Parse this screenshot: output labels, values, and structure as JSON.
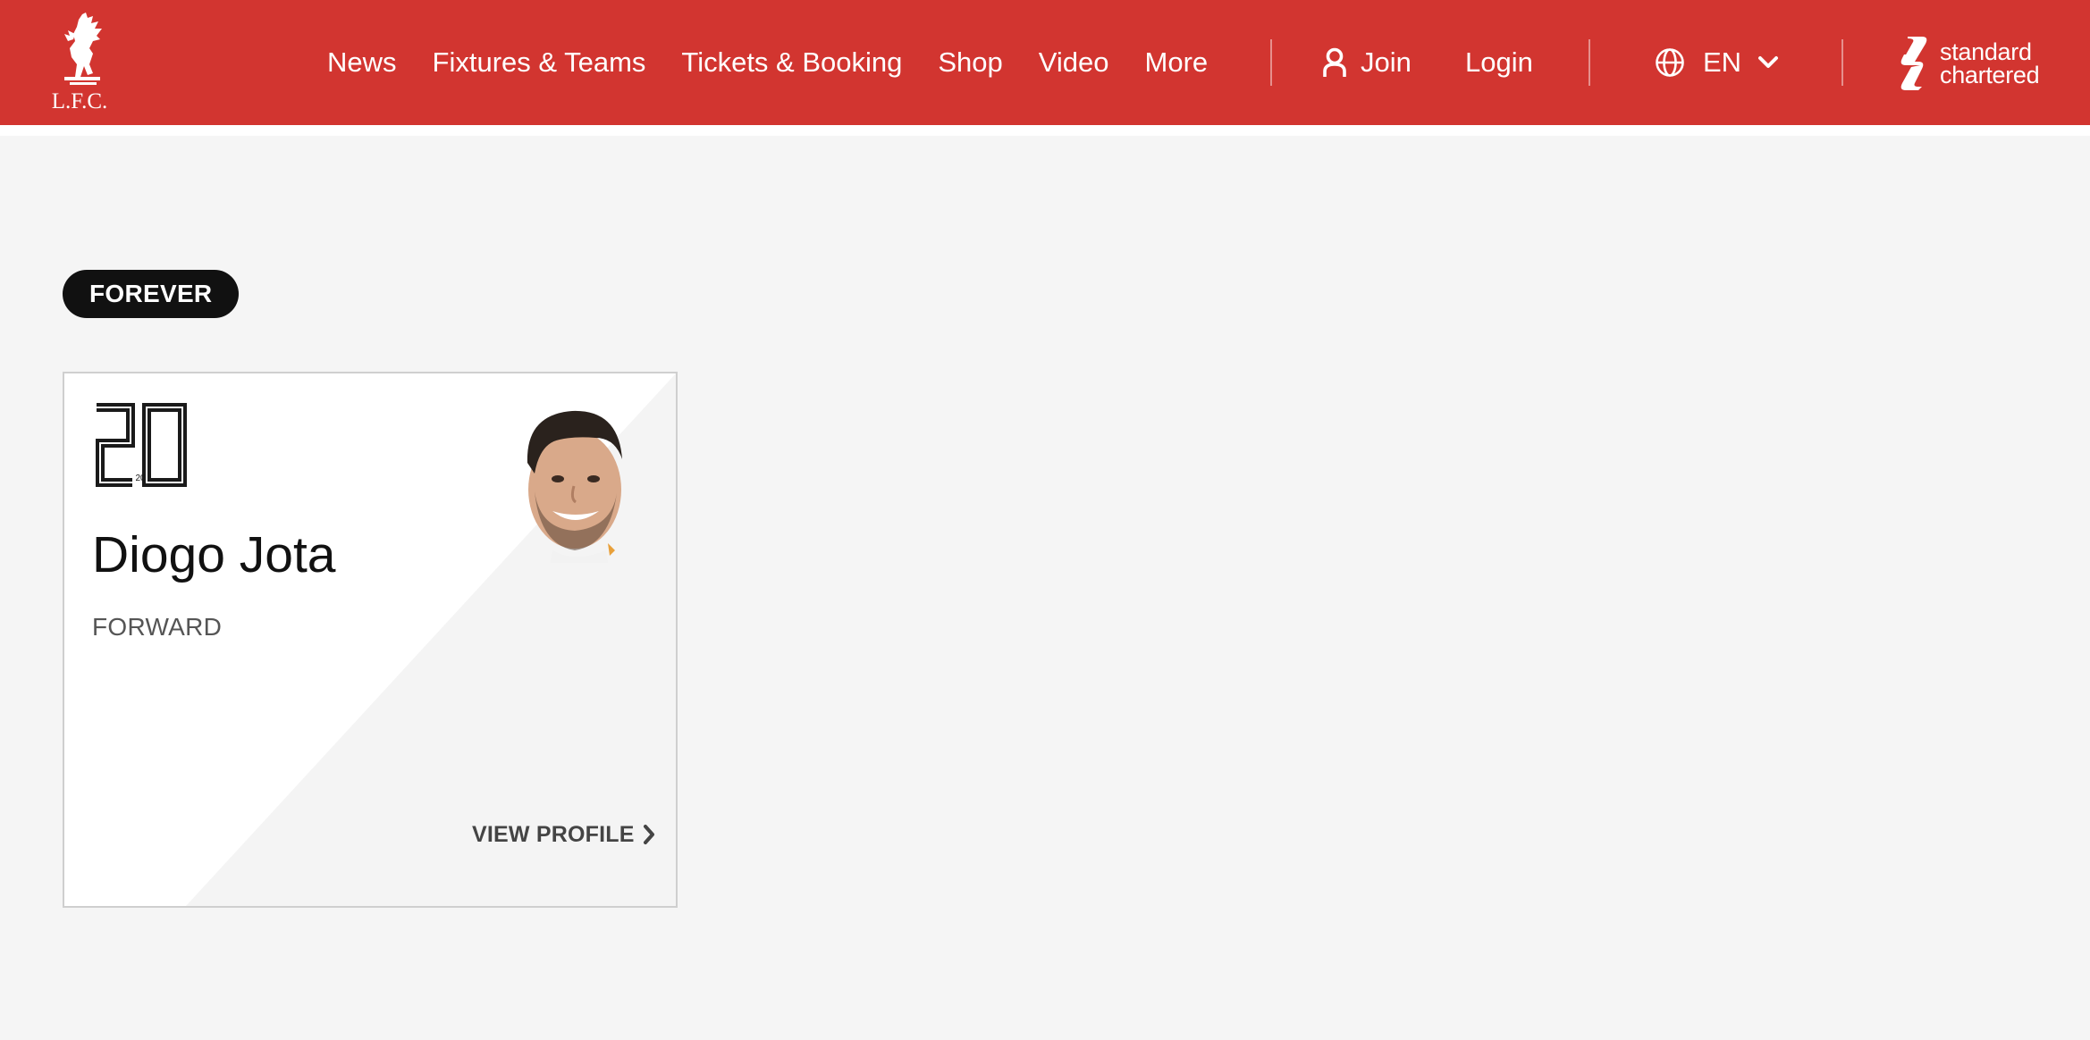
{
  "header": {
    "crest_text": "L.F.C.",
    "nav": [
      "News",
      "Fixtures & Teams",
      "Tickets & Booking",
      "Shop",
      "Video",
      "More"
    ],
    "join_label": "Join",
    "login_label": "Login",
    "language": "EN",
    "sponsor": {
      "line1": "standard",
      "line2": "chartered"
    },
    "brand_color": "#d23530"
  },
  "content": {
    "badge": "FOREVER",
    "player": {
      "number": "20",
      "name": "Diogo Jota",
      "position": "FORWARD",
      "cta": "VIEW PROFILE"
    }
  },
  "icons": {
    "join": "user-icon",
    "language": "globe-icon",
    "language_toggle": "chevron-down-icon",
    "cta": "chevron-right-icon"
  }
}
